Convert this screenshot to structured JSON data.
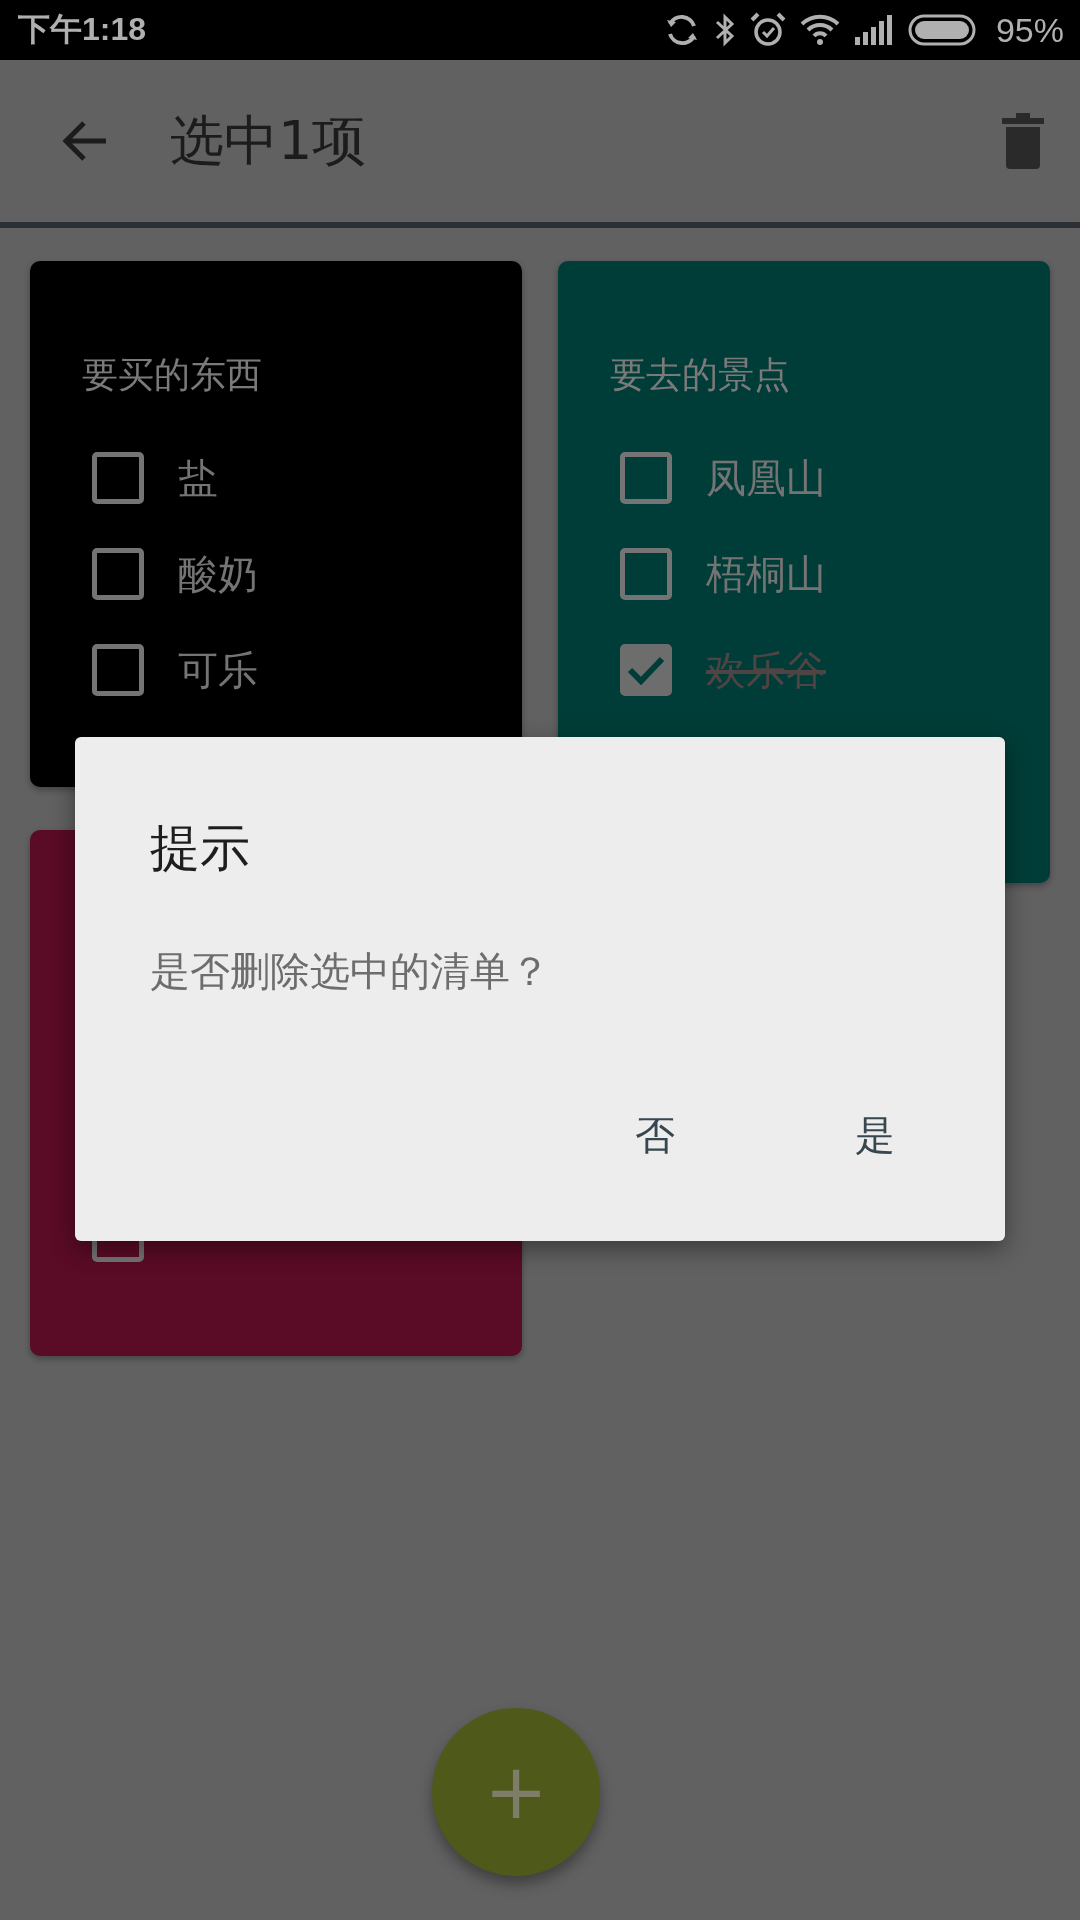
{
  "status_bar": {
    "time": "下午1:18",
    "battery": "95%"
  },
  "toolbar": {
    "title": "选中1项"
  },
  "columns": [
    {
      "cards": [
        {
          "title": "要买的东西",
          "color": "#000000",
          "items": [
            {
              "text": "盐",
              "checked": false
            },
            {
              "text": "酸奶",
              "checked": false
            },
            {
              "text": "可乐",
              "checked": false
            }
          ]
        },
        {
          "color": "#5a0b26",
          "items": [
            {
              "checked": false
            }
          ]
        }
      ]
    },
    {
      "cards": [
        {
          "title": "要去的景点",
          "color": "#003d38",
          "items": [
            {
              "text": "凤凰山",
              "checked": false
            },
            {
              "text": "梧桐山",
              "checked": false
            },
            {
              "text": "欢乐谷",
              "checked": true
            }
          ]
        }
      ]
    }
  ],
  "dialog": {
    "title": "提示",
    "message": "是否删除选中的清单？",
    "buttons": [
      "否",
      "是"
    ]
  },
  "fab": {
    "label": "+"
  }
}
